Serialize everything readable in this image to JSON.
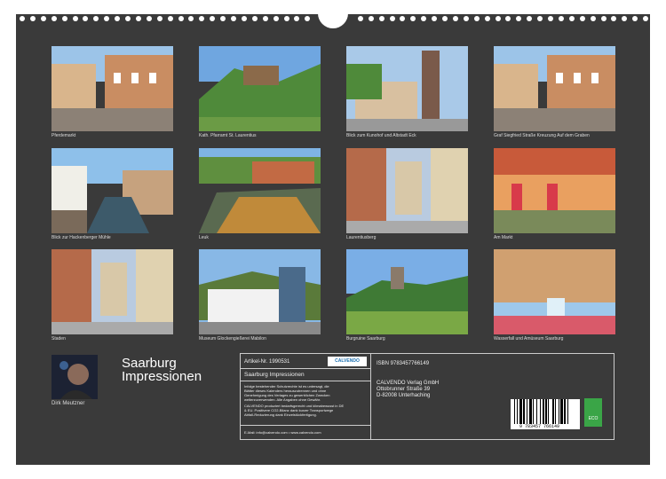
{
  "calendar": {
    "title_line1": "Saarburg",
    "title_line2": "Impressionen",
    "author": "Dirk Meutzner"
  },
  "photos": [
    {
      "caption": "Pferdemarkt",
      "scene": "street"
    },
    {
      "caption": "Kath. Pfarramt St. Laurentius",
      "scene": "hill"
    },
    {
      "caption": "Blick zum Kunohof und Altstadt Eck",
      "scene": "church"
    },
    {
      "caption": "Graf Siegfried Straße Kreuzung Auf dem Graben",
      "scene": "street"
    },
    {
      "caption": "Blick zur Hackenberger Mühle",
      "scene": "canal"
    },
    {
      "caption": "Leuk",
      "scene": "river"
    },
    {
      "caption": "Laurentiusberg",
      "scene": "lane"
    },
    {
      "caption": "Am Markt",
      "scene": "market"
    },
    {
      "caption": "Staden",
      "scene": "lane"
    },
    {
      "caption": "Museum Glockengießerei Mabilon",
      "scene": "museum"
    },
    {
      "caption": "Burgruine Saarburg",
      "scene": "castle"
    },
    {
      "caption": "Wasserfall und Amüseum Saarburg",
      "scene": "waterfall"
    }
  ],
  "info": {
    "article_label": "Artikel-Nr. 1990531",
    "publisher_logo": "CALVENDO",
    "subtitle": "Saarburg Impressionen",
    "legal_1": "Infolge bestehender Schutzrechte ist es untersagt, die",
    "legal_2": "Blätter dieses Kalenders herauszutrennen und ohne",
    "legal_3": "Genehmigung des Verlages zu gewerblichen Zwecken",
    "legal_4": "weiterzuverwenden. Alle Angaben ohne Gewähr.",
    "legal_5": "CALVENDO produziert bedarfsgerecht und klimabewusst in DE",
    "legal_6": "& EU. Positivere CO2-Bilanz dank kurzer Transportwege",
    "legal_7": "Abfall-Reduzierung dank Einzelstückfertigung.",
    "contact": "E-Mail: info@calvendo.com • www.calvendo.com",
    "isbn": "ISBN 9783457766149",
    "publisher_name": "CALVENDO Verlag GmbH",
    "publisher_street": "Ottobrunner Straße 39",
    "publisher_city": "D-82008 Unterhaching",
    "barcode_number": "9 783457 766149",
    "eco_label": "ECO"
  }
}
